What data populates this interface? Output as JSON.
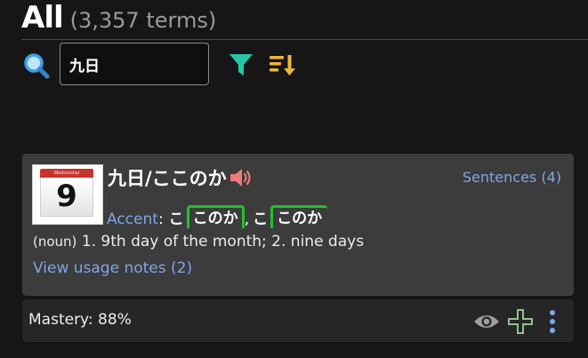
{
  "header": {
    "title": "All",
    "term_count": "(3,357 terms)"
  },
  "search": {
    "value": "九日",
    "search_icon": "search-icon",
    "filter_icon": "filter-icon",
    "sort_icon": "sort-icon"
  },
  "colors": {
    "background": "#161616",
    "card": "#3c3c3c",
    "footer": "#262626",
    "link": "#7ea6e8",
    "pitch_accent": "#22c12b",
    "filter_icon": "#26c6a8",
    "sort_icon": "#f0b63a",
    "speaker_icon": "#ef7a78",
    "search_icon": "#3da0e6"
  },
  "card": {
    "calendar": {
      "day_name": "Wednesday",
      "day_number": "9",
      "icon": "calendar-icon"
    },
    "term": "九日/ここのか",
    "speaker_icon": "speaker-icon",
    "sentences_link": "Sentences (4)",
    "accent": {
      "label": "Accent",
      "colon": ":",
      "readings": [
        {
          "lead": "こ",
          "boxed": "このか"
        },
        {
          "lead": "こ",
          "boxed": "このか"
        }
      ],
      "separator": ","
    },
    "definition": {
      "pos": "(noun)",
      "text": "1. 9th day of the month; 2. nine days"
    },
    "usage_link": "View usage notes (2)"
  },
  "footer": {
    "mastery": "Mastery: 88%",
    "eye_icon": "eye-icon",
    "plus_icon": "plus-icon",
    "more_icon": "more-vertical-icon"
  }
}
